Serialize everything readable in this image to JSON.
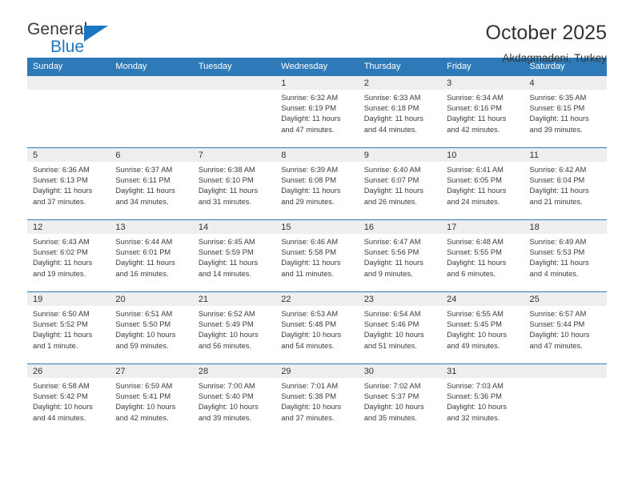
{
  "brand": {
    "name_part1": "General",
    "name_part2": "Blue",
    "triangle_color": "#1c77c3"
  },
  "header": {
    "title": "October 2025",
    "subtitle": "Akdagmadeni, Turkey"
  },
  "theme": {
    "header_blue": "#2e7ab8",
    "daynum_gray": "#eeeeee",
    "text": "#333333"
  },
  "weekday_headers": [
    "Sunday",
    "Monday",
    "Tuesday",
    "Wednesday",
    "Thursday",
    "Friday",
    "Saturday"
  ],
  "labels": {
    "sunrise_prefix": "Sunrise:",
    "sunset_prefix": "Sunset:",
    "daylight_prefix": "Daylight:"
  },
  "weeks": [
    [
      {
        "day": "",
        "empty": true
      },
      {
        "day": "",
        "empty": true
      },
      {
        "day": "",
        "empty": true
      },
      {
        "day": "1",
        "sunrise": "Sunrise: 6:32 AM",
        "sunset": "Sunset: 6:19 PM",
        "daylight_line1": "Daylight: 11 hours",
        "daylight_line2": "and 47 minutes."
      },
      {
        "day": "2",
        "sunrise": "Sunrise: 6:33 AM",
        "sunset": "Sunset: 6:18 PM",
        "daylight_line1": "Daylight: 11 hours",
        "daylight_line2": "and 44 minutes."
      },
      {
        "day": "3",
        "sunrise": "Sunrise: 6:34 AM",
        "sunset": "Sunset: 6:16 PM",
        "daylight_line1": "Daylight: 11 hours",
        "daylight_line2": "and 42 minutes."
      },
      {
        "day": "4",
        "sunrise": "Sunrise: 6:35 AM",
        "sunset": "Sunset: 6:15 PM",
        "daylight_line1": "Daylight: 11 hours",
        "daylight_line2": "and 39 minutes."
      }
    ],
    [
      {
        "day": "5",
        "sunrise": "Sunrise: 6:36 AM",
        "sunset": "Sunset: 6:13 PM",
        "daylight_line1": "Daylight: 11 hours",
        "daylight_line2": "and 37 minutes."
      },
      {
        "day": "6",
        "sunrise": "Sunrise: 6:37 AM",
        "sunset": "Sunset: 6:11 PM",
        "daylight_line1": "Daylight: 11 hours",
        "daylight_line2": "and 34 minutes."
      },
      {
        "day": "7",
        "sunrise": "Sunrise: 6:38 AM",
        "sunset": "Sunset: 6:10 PM",
        "daylight_line1": "Daylight: 11 hours",
        "daylight_line2": "and 31 minutes."
      },
      {
        "day": "8",
        "sunrise": "Sunrise: 6:39 AM",
        "sunset": "Sunset: 6:08 PM",
        "daylight_line1": "Daylight: 11 hours",
        "daylight_line2": "and 29 minutes."
      },
      {
        "day": "9",
        "sunrise": "Sunrise: 6:40 AM",
        "sunset": "Sunset: 6:07 PM",
        "daylight_line1": "Daylight: 11 hours",
        "daylight_line2": "and 26 minutes."
      },
      {
        "day": "10",
        "sunrise": "Sunrise: 6:41 AM",
        "sunset": "Sunset: 6:05 PM",
        "daylight_line1": "Daylight: 11 hours",
        "daylight_line2": "and 24 minutes."
      },
      {
        "day": "11",
        "sunrise": "Sunrise: 6:42 AM",
        "sunset": "Sunset: 6:04 PM",
        "daylight_line1": "Daylight: 11 hours",
        "daylight_line2": "and 21 minutes."
      }
    ],
    [
      {
        "day": "12",
        "sunrise": "Sunrise: 6:43 AM",
        "sunset": "Sunset: 6:02 PM",
        "daylight_line1": "Daylight: 11 hours",
        "daylight_line2": "and 19 minutes."
      },
      {
        "day": "13",
        "sunrise": "Sunrise: 6:44 AM",
        "sunset": "Sunset: 6:01 PM",
        "daylight_line1": "Daylight: 11 hours",
        "daylight_line2": "and 16 minutes."
      },
      {
        "day": "14",
        "sunrise": "Sunrise: 6:45 AM",
        "sunset": "Sunset: 5:59 PM",
        "daylight_line1": "Daylight: 11 hours",
        "daylight_line2": "and 14 minutes."
      },
      {
        "day": "15",
        "sunrise": "Sunrise: 6:46 AM",
        "sunset": "Sunset: 5:58 PM",
        "daylight_line1": "Daylight: 11 hours",
        "daylight_line2": "and 11 minutes."
      },
      {
        "day": "16",
        "sunrise": "Sunrise: 6:47 AM",
        "sunset": "Sunset: 5:56 PM",
        "daylight_line1": "Daylight: 11 hours",
        "daylight_line2": "and 9 minutes."
      },
      {
        "day": "17",
        "sunrise": "Sunrise: 6:48 AM",
        "sunset": "Sunset: 5:55 PM",
        "daylight_line1": "Daylight: 11 hours",
        "daylight_line2": "and 6 minutes."
      },
      {
        "day": "18",
        "sunrise": "Sunrise: 6:49 AM",
        "sunset": "Sunset: 5:53 PM",
        "daylight_line1": "Daylight: 11 hours",
        "daylight_line2": "and 4 minutes."
      }
    ],
    [
      {
        "day": "19",
        "sunrise": "Sunrise: 6:50 AM",
        "sunset": "Sunset: 5:52 PM",
        "daylight_line1": "Daylight: 11 hours",
        "daylight_line2": "and 1 minute."
      },
      {
        "day": "20",
        "sunrise": "Sunrise: 6:51 AM",
        "sunset": "Sunset: 5:50 PM",
        "daylight_line1": "Daylight: 10 hours",
        "daylight_line2": "and 59 minutes."
      },
      {
        "day": "21",
        "sunrise": "Sunrise: 6:52 AM",
        "sunset": "Sunset: 5:49 PM",
        "daylight_line1": "Daylight: 10 hours",
        "daylight_line2": "and 56 minutes."
      },
      {
        "day": "22",
        "sunrise": "Sunrise: 6:53 AM",
        "sunset": "Sunset: 5:48 PM",
        "daylight_line1": "Daylight: 10 hours",
        "daylight_line2": "and 54 minutes."
      },
      {
        "day": "23",
        "sunrise": "Sunrise: 6:54 AM",
        "sunset": "Sunset: 5:46 PM",
        "daylight_line1": "Daylight: 10 hours",
        "daylight_line2": "and 51 minutes."
      },
      {
        "day": "24",
        "sunrise": "Sunrise: 6:55 AM",
        "sunset": "Sunset: 5:45 PM",
        "daylight_line1": "Daylight: 10 hours",
        "daylight_line2": "and 49 minutes."
      },
      {
        "day": "25",
        "sunrise": "Sunrise: 6:57 AM",
        "sunset": "Sunset: 5:44 PM",
        "daylight_line1": "Daylight: 10 hours",
        "daylight_line2": "and 47 minutes."
      }
    ],
    [
      {
        "day": "26",
        "sunrise": "Sunrise: 6:58 AM",
        "sunset": "Sunset: 5:42 PM",
        "daylight_line1": "Daylight: 10 hours",
        "daylight_line2": "and 44 minutes."
      },
      {
        "day": "27",
        "sunrise": "Sunrise: 6:59 AM",
        "sunset": "Sunset: 5:41 PM",
        "daylight_line1": "Daylight: 10 hours",
        "daylight_line2": "and 42 minutes."
      },
      {
        "day": "28",
        "sunrise": "Sunrise: 7:00 AM",
        "sunset": "Sunset: 5:40 PM",
        "daylight_line1": "Daylight: 10 hours",
        "daylight_line2": "and 39 minutes."
      },
      {
        "day": "29",
        "sunrise": "Sunrise: 7:01 AM",
        "sunset": "Sunset: 5:38 PM",
        "daylight_line1": "Daylight: 10 hours",
        "daylight_line2": "and 37 minutes."
      },
      {
        "day": "30",
        "sunrise": "Sunrise: 7:02 AM",
        "sunset": "Sunset: 5:37 PM",
        "daylight_line1": "Daylight: 10 hours",
        "daylight_line2": "and 35 minutes."
      },
      {
        "day": "31",
        "sunrise": "Sunrise: 7:03 AM",
        "sunset": "Sunset: 5:36 PM",
        "daylight_line1": "Daylight: 10 hours",
        "daylight_line2": "and 32 minutes."
      },
      {
        "day": "",
        "empty": true
      }
    ]
  ]
}
